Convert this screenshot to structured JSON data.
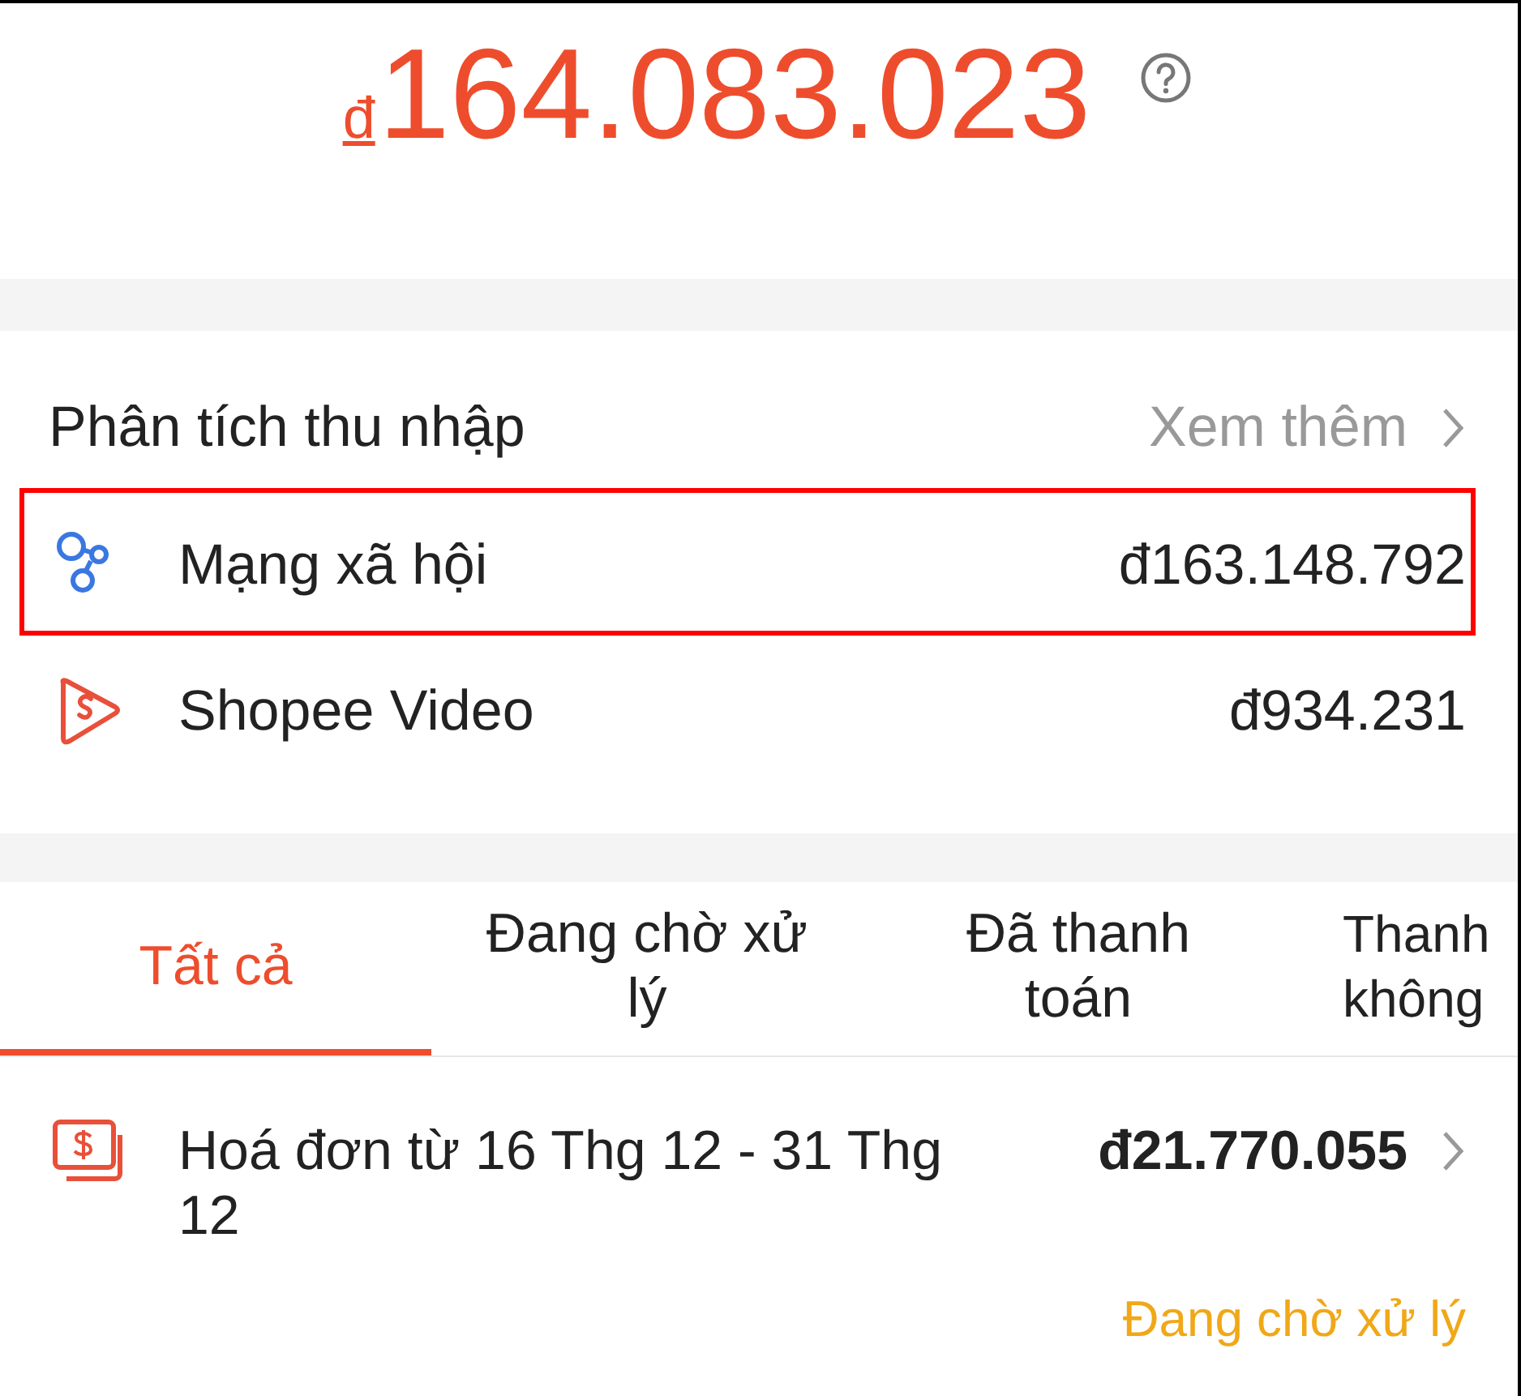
{
  "balance": {
    "currency": "đ",
    "amount": "164.083.023"
  },
  "income_analysis": {
    "title": "Phân tích thu nhập",
    "more_link": "Xem thêm",
    "sources": [
      {
        "kind": "social",
        "label": "Mạng xã hội",
        "amount": "đ163.148.792",
        "highlighted": true
      },
      {
        "kind": "video",
        "label": "Shopee Video",
        "amount": "đ934.231",
        "highlighted": false
      }
    ]
  },
  "tabs": [
    {
      "label": "Tất cả",
      "selected": true
    },
    {
      "label": "Đang chờ xử lý",
      "selected": false
    },
    {
      "label": "Đã thanh toán",
      "selected": false
    },
    {
      "label": "Thanh không",
      "selected": false
    }
  ],
  "invoices": [
    {
      "title": "Hoá đơn từ 16 Thg 12 - 31 Thg 12",
      "amount": "đ21.770.055",
      "status": "Đang chờ xử lý"
    }
  ]
}
